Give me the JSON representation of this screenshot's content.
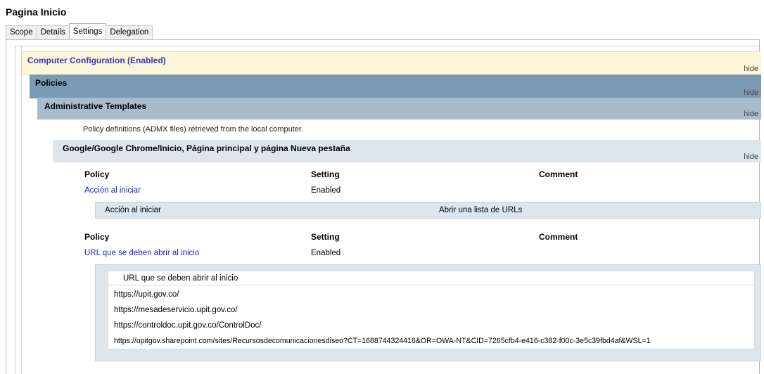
{
  "window": {
    "title": "Pagina Inicio"
  },
  "tabs": [
    {
      "label": "Scope"
    },
    {
      "label": "Details"
    },
    {
      "label": "Settings",
      "active": true
    },
    {
      "label": "Delegation"
    }
  ],
  "sections": {
    "computer_config": {
      "label": "Computer Configuration (Enabled)",
      "hide": "hide"
    },
    "policies": {
      "label": "Policies",
      "hide": "hide"
    },
    "admin_templates": {
      "label": "Administrative Templates",
      "hide": "hide"
    },
    "admx_note": "Policy definitions (ADMX files) retrieved from the local computer.",
    "chrome_category": {
      "label": "Google/Google Chrome/Inicio, Página principal y página Nueva pestaña",
      "hide": "hide"
    }
  },
  "table1": {
    "headers": {
      "policy": "Policy",
      "setting": "Setting",
      "comment": "Comment"
    },
    "row": {
      "policy": "Acción al iniciar",
      "setting": "Enabled"
    },
    "detail": {
      "name": "Acción al iniciar",
      "value": "Abrir una lista de URLs"
    }
  },
  "table2": {
    "headers": {
      "policy": "Policy",
      "setting": "Setting",
      "comment": "Comment"
    },
    "row": {
      "policy": "URL que se deben abrir al inicio",
      "setting": "Enabled"
    },
    "urls_header": "URL que se deben abrir al inicio",
    "urls": [
      "https://upit.gov.co/",
      "https://mesadeservicio.upit.gov.co/",
      "https://controldoc.upit.gov.co/ControlDoc/",
      "https://upitgov.sharepoint.com/sites/Recursosdecomunicacionesdiseo?CT=1688744324416&OR=OWA-NT&CID=7265cfb4-e416-c382-f00c-3e5c39fbd4af&WSL=1"
    ]
  },
  "colors": {
    "computer_config_bg": "#fdf6d8",
    "policies_bg": "#7b9bb4",
    "admin_templates_bg": "#a8bcce",
    "category_bg": "#dde6ed",
    "link": "#1b1bc8"
  }
}
